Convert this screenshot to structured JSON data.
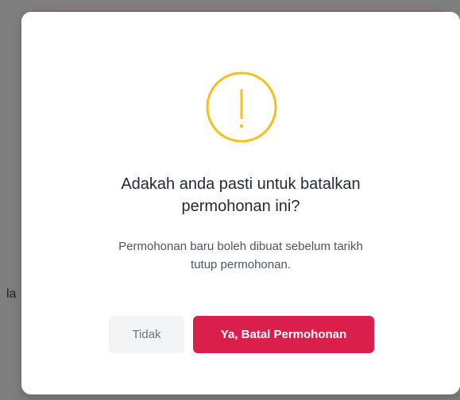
{
  "background": {
    "left_text": "la"
  },
  "modal": {
    "icon": "exclamation-circle-icon",
    "accent_color": "#f3c119",
    "title_lines": [
      "Adakah anda pasti untuk batalkan",
      "permohonan ini?"
    ],
    "description_lines": [
      "Permohonan baru boleh dibuat sebelum tarikh",
      "tutup permohonan."
    ],
    "buttons": {
      "no_label": "Tidak",
      "yes_label": "Ya, Batal Permohonan",
      "yes_color": "#db1f4d"
    }
  }
}
